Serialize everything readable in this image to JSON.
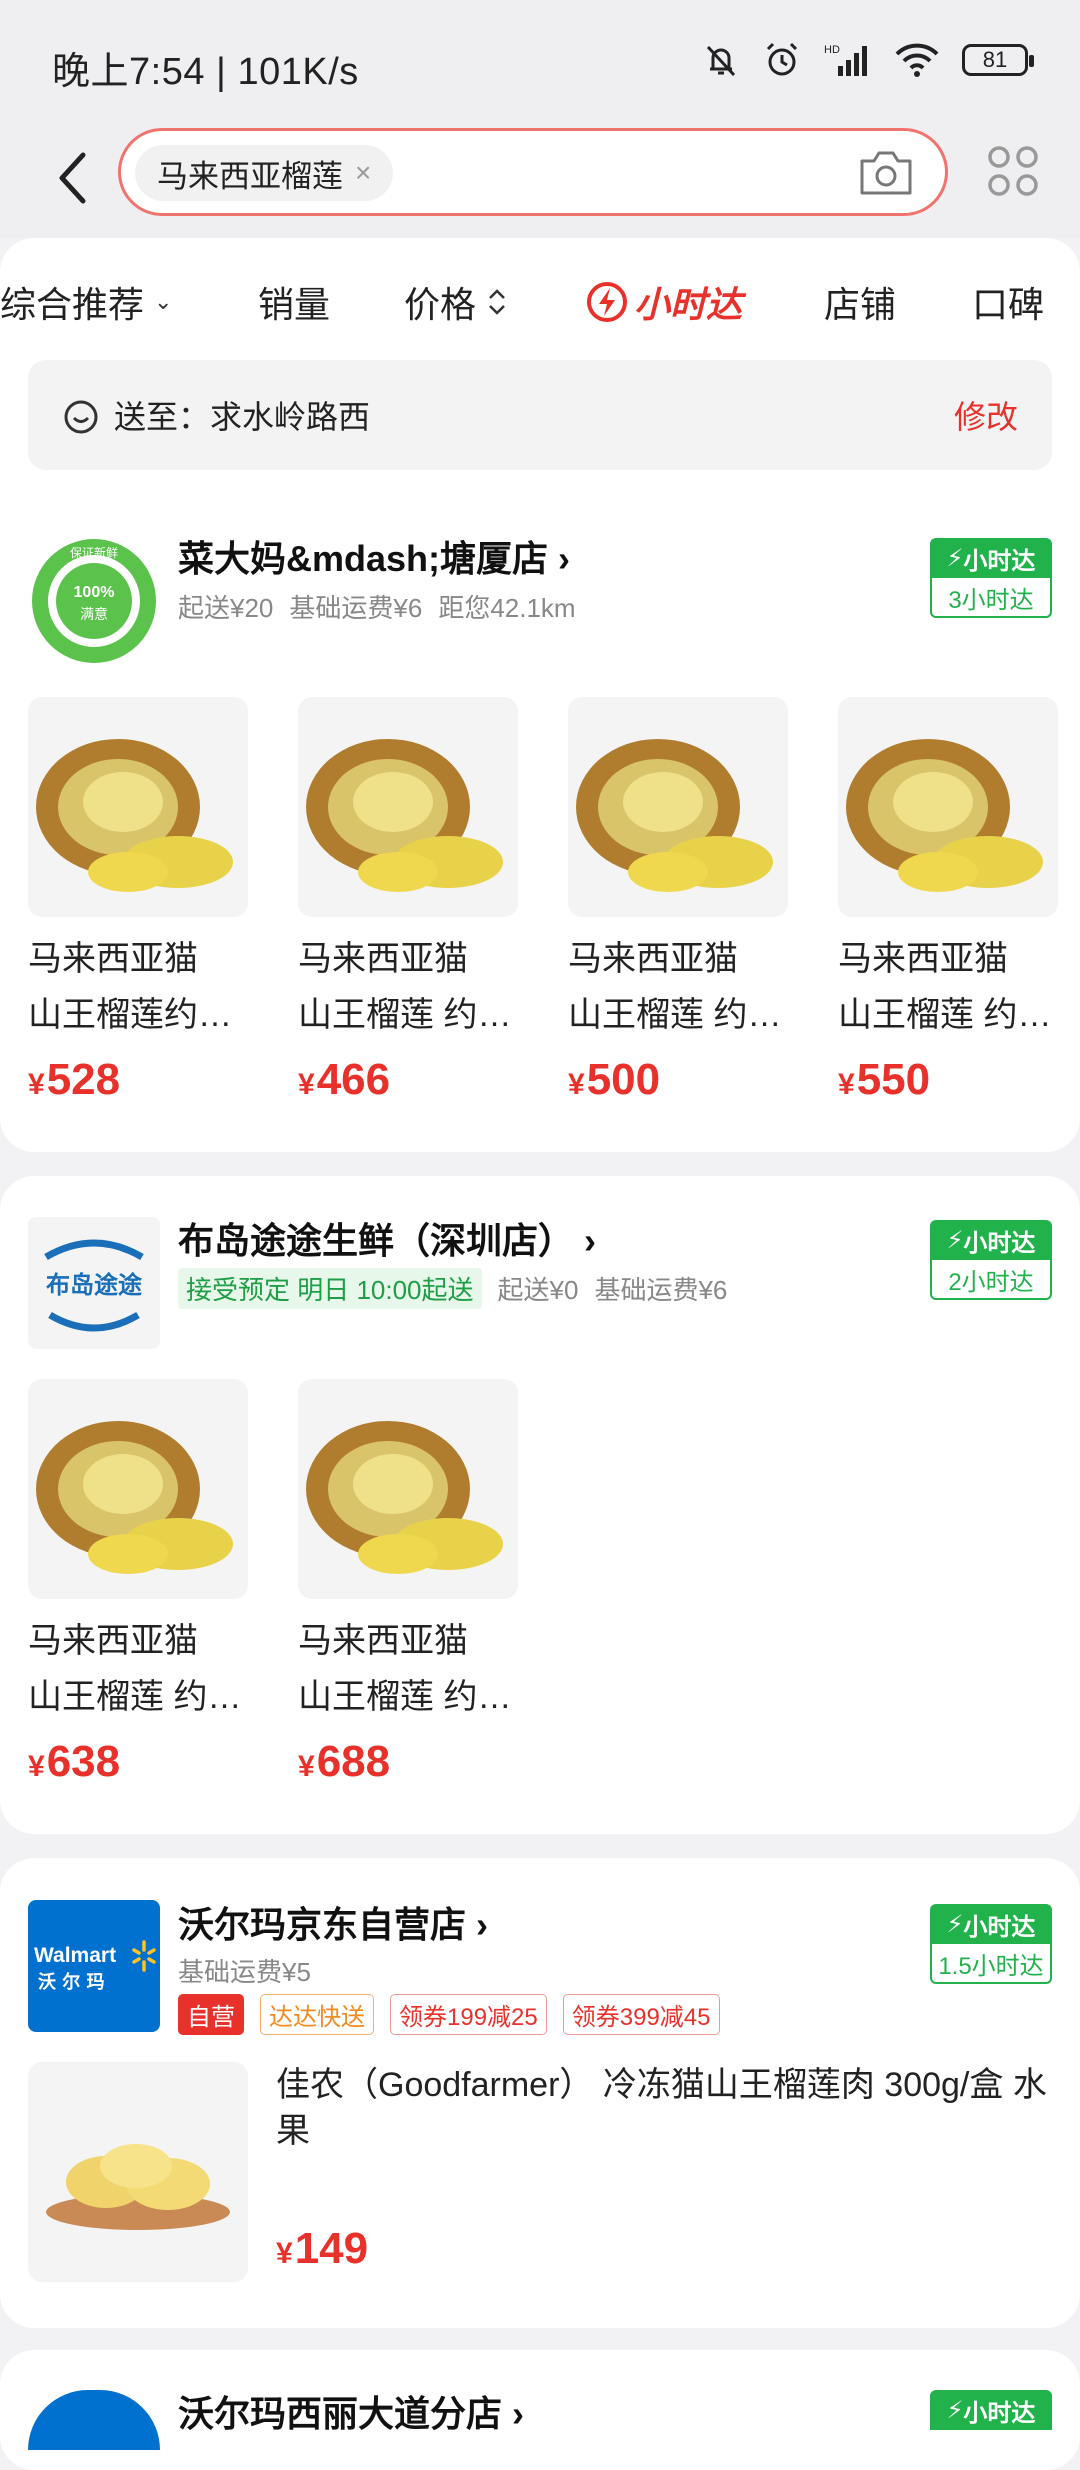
{
  "status_bar": {
    "time": "晚上7:54 | 101K/s",
    "battery": "81"
  },
  "search": {
    "query": "马来西亚榴莲",
    "clear_icon": "×"
  },
  "tabs": {
    "comprehensive": "综合推荐",
    "sales": "销量",
    "price": "价格",
    "hour_delivery": "小时达",
    "shop": "店铺",
    "reviews": "口碑"
  },
  "address": {
    "label": "送至：求水岭路西",
    "edit": "修改"
  },
  "stores": [
    {
      "name": "菜大妈&mdash;塘厦店",
      "meta": [
        "起送¥20",
        "基础运费¥6",
        "距您42.1km"
      ],
      "badge_top": "小时达",
      "badge_bottom": "3小时达",
      "logo_text": [
        "保证新鲜",
        "100%",
        "满意"
      ],
      "products": [
        {
          "line1": "马来西亚猫",
          "line2": "山王榴莲约…",
          "price": "528"
        },
        {
          "line1": "马来西亚猫",
          "line2": "山王榴莲 约…",
          "price": "466"
        },
        {
          "line1": "马来西亚猫",
          "line2": "山王榴莲 约…",
          "price": "500"
        },
        {
          "line1": "马来西亚猫",
          "line2": "山王榴莲 约…",
          "price": "550"
        }
      ]
    },
    {
      "name": "布岛途途生鲜（深圳店）",
      "preorder": "接受预定 明日 10:00起送",
      "meta": [
        "起送¥0",
        "基础运费¥6"
      ],
      "badge_top": "小时达",
      "badge_bottom": "2小时达",
      "logo_text": "布岛途途",
      "products": [
        {
          "line1": "马来西亚猫",
          "line2": "山王榴莲 约…",
          "price": "638"
        },
        {
          "line1": "马来西亚猫",
          "line2": "山王榴莲 约…",
          "price": "688"
        }
      ]
    },
    {
      "name": "沃尔玛京东自营店",
      "meta": [
        "基础运费¥5"
      ],
      "tags": [
        "自营",
        "达达快送",
        "领券199减25",
        "领券399减45"
      ],
      "badge_top": "小时达",
      "badge_bottom": "1.5小时达",
      "logo_text": [
        "Walmart",
        "沃 尔 玛"
      ],
      "products": [
        {
          "title": "佳农（Goodfarmer） 冷冻猫山王榴莲肉 300g/盒 水果",
          "price": "149"
        }
      ]
    },
    {
      "name": "沃尔玛西丽大道分店",
      "badge_top": "小时达"
    }
  ],
  "currency": "¥",
  "colors": {
    "accent_red": "#e8312b",
    "badge_green": "#21b24b",
    "search_border": "#f0736f"
  }
}
